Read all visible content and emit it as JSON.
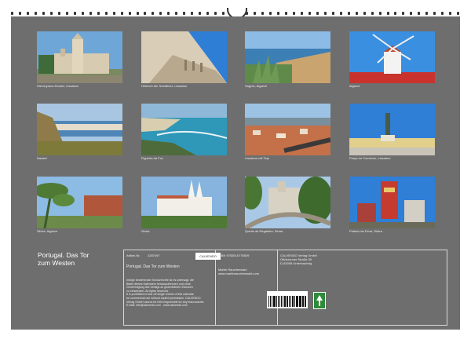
{
  "calendar": {
    "title_line1": "Portugal. Das Tor",
    "title_line2": "zum Westen",
    "article_label": "Artikel-Nr.",
    "article_number": "2287497",
    "calendar_name": "Portugal. Das Tor zum Westen",
    "isbn": "ISBN 9783516778539",
    "author": "Martin Rauchenwald",
    "author_site": "www.martinrauchenwald.com",
    "publisher_name": "CALVENDO Verlag GmbH",
    "publisher_street": "Ottobrunner Straße 39",
    "publisher_city": "D-82008 Unterhaching",
    "logo_text": "CALVENDO",
    "disclaimer_lines": [
      "Infolge bestehender Schutzrechte ist es untersagt, die",
      "Bilder dieses Kalenders herauszutrennen und ohne",
      "Genehmigung des Verlags zu gewerblichen Zwecken",
      "zu verwenden. All rights reserved.",
      "It is prohibited to tear off single sheets of this calendar",
      "for commercial use without explicit permission. CALVENDO",
      "Verlag GmbH cannot be held responsible for any inaccuracies.",
      "E-Mail: info@calvendo.com · www.calvendo.com"
    ]
  },
  "photos": [
    {
      "caption": "Hieronymus-Kloster, Lissabon",
      "palette": "belem"
    },
    {
      "caption": "Heinrich der Seefahrer, Lissabon",
      "palette": "monument"
    },
    {
      "caption": "Sagres, Algarve",
      "palette": "coast"
    },
    {
      "caption": "Algarve",
      "palette": "windmill"
    },
    {
      "caption": "Nazaré",
      "palette": "cliff"
    },
    {
      "caption": "Figueira da Foz",
      "palette": "beach"
    },
    {
      "caption": "Lissabon mit Tejo",
      "palette": "rooftops"
    },
    {
      "caption": "Praça do Comércio, Lissabon",
      "palette": "square"
    },
    {
      "caption": "Silves, Algarve",
      "palette": "palms"
    },
    {
      "caption": "Sintra",
      "palette": "sintra"
    },
    {
      "caption": "Quinta da Regaleira, Sintra",
      "palette": "regaleira"
    },
    {
      "caption": "Palácio da Pena, Sintra",
      "palette": "pena"
    }
  ]
}
